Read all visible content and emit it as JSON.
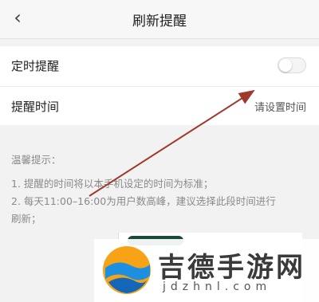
{
  "header": {
    "title": "刷新提醒",
    "back_icon": "chevron-left-icon"
  },
  "settings": {
    "timer_label": "定时提醒",
    "timer_enabled": false,
    "time_label": "提醒时间",
    "time_value": "请设置时间"
  },
  "tips": {
    "title": "温馨提示：",
    "line1": "1. 提醒的时间将以本手机设定的时间为标准；",
    "line2": "2. 每天11:00–16:00为用户数高峰，建议选择此段时间进行",
    "line3": "刷新；"
  },
  "watermark": {
    "name": "吉德手游网",
    "domain": "jdzhnl.com"
  },
  "colors": {
    "arrow": "#a0392c",
    "accent": "#184a3c"
  }
}
